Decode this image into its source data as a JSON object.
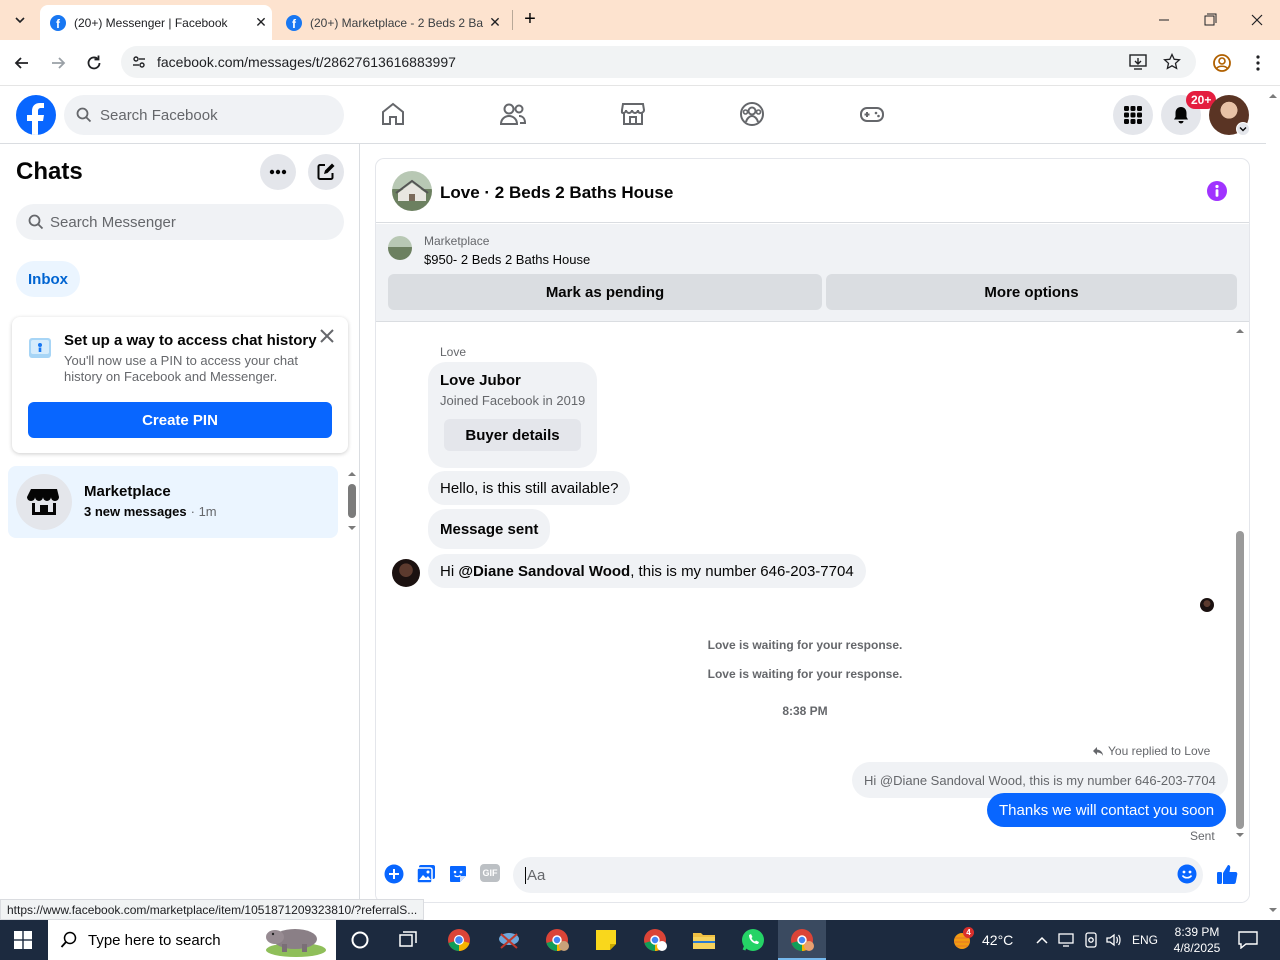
{
  "browser": {
    "tabs": [
      {
        "title": "(20+) Messenger | Facebook",
        "active": true
      },
      {
        "title": "(20+) Marketplace - 2 Beds 2 Ba",
        "active": false
      }
    ],
    "url": "facebook.com/messages/t/28627613616883997",
    "status_url": "https://www.facebook.com/marketplace/item/1051871209323810/?referralS..."
  },
  "facebook": {
    "search_placeholder": "Search Facebook",
    "notification_badge": "20+"
  },
  "left": {
    "title": "Chats",
    "search_placeholder": "Search Messenger",
    "filter": "Inbox",
    "pin_card": {
      "title": "Set up a way to access chat history",
      "body": "You'll now use a PIN to access your chat history on Facebook and Messenger.",
      "button": "Create PIN"
    },
    "chat": {
      "name": "Marketplace",
      "preview": "3 new messages",
      "time": "· 1m"
    }
  },
  "convo": {
    "title": "Love · 2 Beds 2 Baths House",
    "listing": {
      "label": "Marketplace",
      "price_title": "$950- 2 Beds 2 Baths House",
      "mark_pending": "Mark as pending",
      "more_options": "More options"
    },
    "sender_label": "Love",
    "profile_card": {
      "name": "Love Jubor",
      "joined": "Joined Facebook in 2019",
      "button": "Buyer details"
    },
    "msg_available": "Hello, is this still available?",
    "msg_sent": "Message sent",
    "msg_number_pre": "Hi ",
    "msg_number_mention": "@Diane Sandoval Wood",
    "msg_number_post": ", this is my number 646-203-7704",
    "waiting1": "Love is waiting for your response.",
    "waiting2": "Love is waiting for your response.",
    "time": "8:38 PM",
    "replied_to": "You replied to Love",
    "quoted": "Hi @Diane Sandoval Wood, this is my number 646-203-7704",
    "my_message": "Thanks we will contact you soon",
    "status": "Sent",
    "composer_placeholder": "Aa"
  },
  "taskbar": {
    "search_placeholder": "Type here to search",
    "weather_badge": "4",
    "temperature": "42°C",
    "language": "ENG",
    "time": "8:39 PM",
    "date": "4/8/2025"
  },
  "colors": {
    "fb_blue": "#0866ff",
    "accent_purple": "#a033ff",
    "tab_bar": "#fde3cf",
    "badge_red": "#e41e3f"
  }
}
